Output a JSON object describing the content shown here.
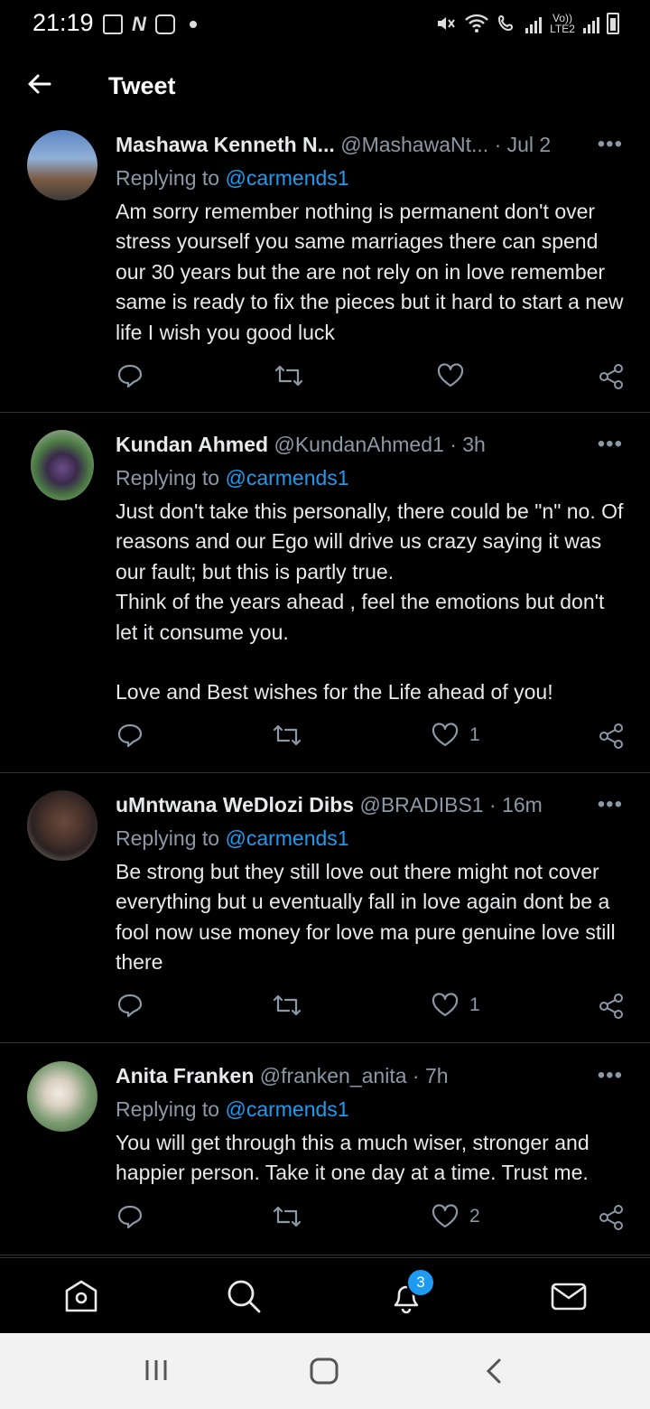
{
  "status_bar": {
    "time": "21:19",
    "network_label": "Vo)) LTE2"
  },
  "header": {
    "title": "Tweet"
  },
  "tweets": [
    {
      "name": "Mashawa Kenneth N...",
      "handle": "@MashawaNt...",
      "time": "· Jul 2",
      "replying_prefix": "Replying to ",
      "replying_to": "@carmends1",
      "text": "Am sorry remember nothing is permanent don't over stress yourself you same marriages there can spend our 30 years but the are not rely on in love remember same is ready to fix the pieces but it hard to start a new life I wish you good luck",
      "likes": "",
      "avatar_colors": [
        "#4a6fa8",
        "#c9a27a"
      ]
    },
    {
      "name": "Kundan Ahmed",
      "handle": "@KundanAhmed1",
      "time": "· 3h",
      "replying_prefix": "Replying to ",
      "replying_to": "@carmends1",
      "text": "Just don't take this personally, there could be \"n\" no. Of reasons and our Ego will drive us crazy saying it was our fault; but this is partly true.\nThink of the years ahead , feel the emotions but don't let it consume you.\n\nLove and Best wishes for the Life ahead of you!",
      "likes": "1",
      "avatar_colors": [
        "#3f6b3a",
        "#8a6a9a"
      ]
    },
    {
      "name": "uMntwana WeDlozi Dibs",
      "handle": "@BRADIBS1",
      "time": "· 16m",
      "replying_prefix": "Replying to ",
      "replying_to": "@carmends1",
      "text": "Be strong but they still love out there might not cover everything but u eventually fall in love again dont be a fool now use money for love ma pure genuine love still there",
      "likes": "1",
      "avatar_colors": [
        "#5a4a44",
        "#2a2020"
      ]
    },
    {
      "name": "Anita Franken",
      "handle": "@franken_anita",
      "time": "· 7h",
      "replying_prefix": "Replying to ",
      "replying_to": "@carmends1",
      "text": "You will get through this a much wiser, stronger and happier person. Take it one day at a time. Trust me.",
      "likes": "2",
      "avatar_colors": [
        "#6f8f6a",
        "#e8e2d6"
      ]
    }
  ],
  "bottom_nav": {
    "notifications_badge": "3"
  },
  "colors": {
    "background": "#000000",
    "accent": "#1d9bf0",
    "muted": "#8b98a5",
    "divider": "#2f3336"
  }
}
